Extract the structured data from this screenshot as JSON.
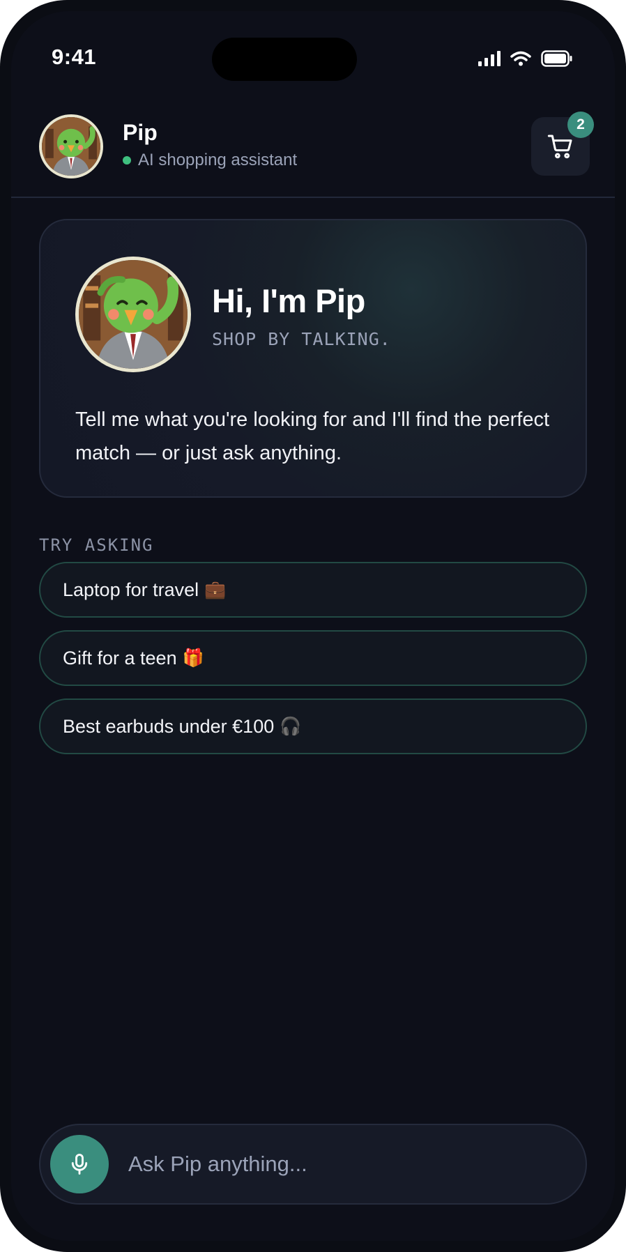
{
  "status_bar": {
    "time": "9:41",
    "icons": [
      "signal-icon",
      "wifi-icon",
      "battery-icon"
    ]
  },
  "header": {
    "name": "Pip",
    "subtitle": "AI shopping assistant",
    "online": true,
    "cart_count": "2",
    "icons": {
      "avatar": "parrot-avatar-icon",
      "cart": "cart-icon"
    }
  },
  "hero": {
    "title": "Hi, I'm Pip",
    "tagline": "SHOP BY TALKING.",
    "description": "Tell me what you're looking for and I'll find the perfect match — or just ask anything."
  },
  "suggestions": {
    "label": "TRY ASKING",
    "items": [
      {
        "text": "Laptop for travel",
        "emoji": "💼"
      },
      {
        "text": "Gift for a teen",
        "emoji": "🎁"
      },
      {
        "text": "Best earbuds under €100",
        "emoji": "🎧"
      }
    ]
  },
  "input": {
    "placeholder": "Ask Pip anything...",
    "value": "",
    "icons": {
      "mic": "microphone-icon"
    }
  },
  "colors": {
    "accent": "#3a8e7e",
    "background": "#0d0f19",
    "online": "#3fbf7f"
  }
}
